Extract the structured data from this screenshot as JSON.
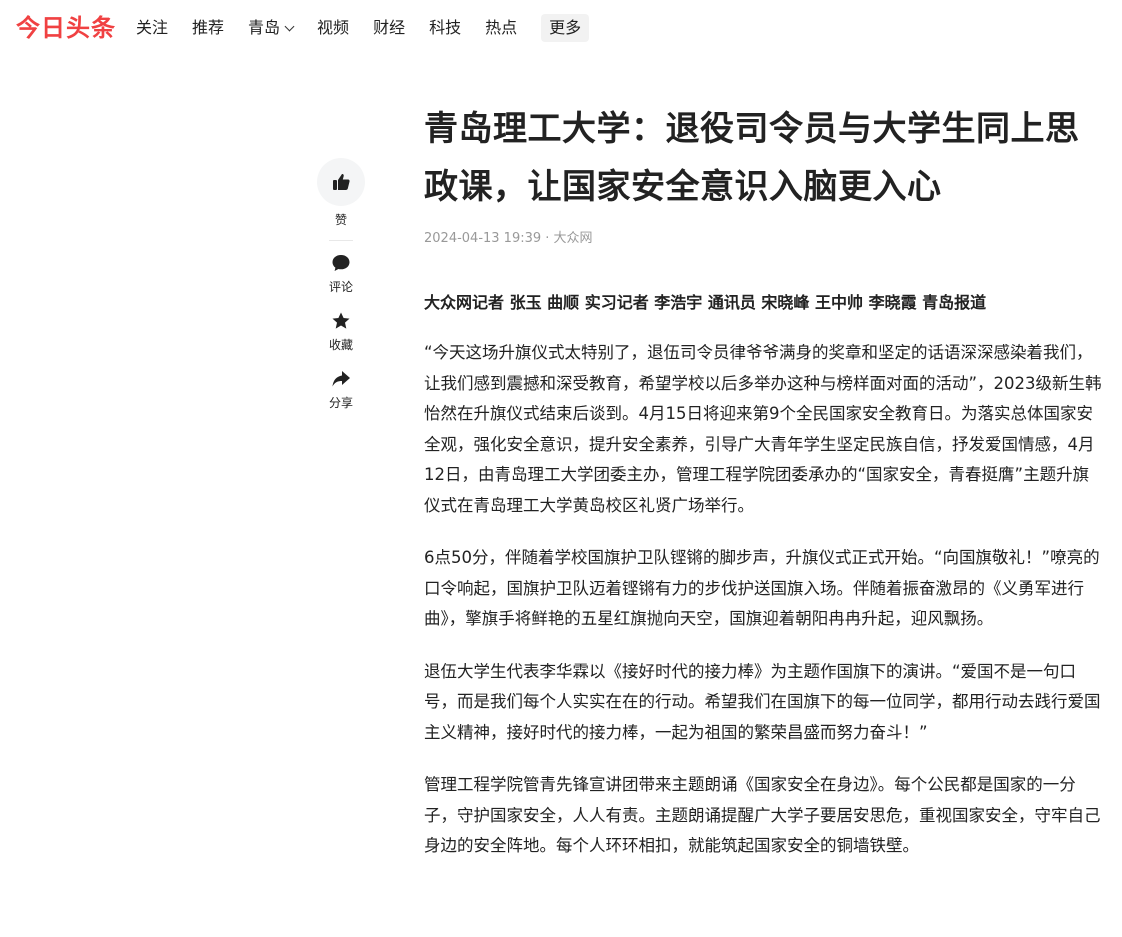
{
  "brand": {
    "logo": "今日头条",
    "accent": "#f04142"
  },
  "nav": {
    "items": [
      {
        "label": "关注"
      },
      {
        "label": "推荐"
      },
      {
        "label": "青岛",
        "has_dropdown": true
      },
      {
        "label": "视频"
      },
      {
        "label": "财经"
      },
      {
        "label": "科技"
      },
      {
        "label": "热点"
      },
      {
        "label": "更多",
        "highlighted": true
      }
    ]
  },
  "sidebar": {
    "like": {
      "label": "赞",
      "icon": "thumbs-up-icon"
    },
    "comment": {
      "label": "评论",
      "icon": "comment-icon"
    },
    "favorite": {
      "label": "收藏",
      "icon": "star-icon"
    },
    "share": {
      "label": "分享",
      "icon": "share-icon"
    }
  },
  "article": {
    "title": "青岛理工大学：退役司令员与大学生同上思政课，让国家安全意识入脑更入心",
    "meta": "2024-04-13 19:39 · 大众网",
    "byline": "大众网记者 张玉 曲顺 实习记者 李浩宇 通讯员 宋晓峰 王中帅 李晓霞 青岛报道",
    "paragraphs": [
      "“今天这场升旗仪式太特别了，退伍司令员律爷爷满身的奖章和坚定的话语深深感染着我们，让我们感到震撼和深受教育，希望学校以后多举办这种与榜样面对面的活动”，2023级新生韩怡然在升旗仪式结束后谈到。4月15日将迎来第9个全民国家安全教育日。为落实总体国家安全观，强化安全意识，提升安全素养，引导广大青年学生坚定民族自信，抒发爱国情感，4月12日，由青岛理工大学团委主办，管理工程学院团委承办的“国家安全，青春挺膺”主题升旗仪式在青岛理工大学黄岛校区礼贤广场举行。",
      "6点50分，伴随着学校国旗护卫队铿锵的脚步声，升旗仪式正式开始。“向国旗敬礼！”嘹亮的口令响起，国旗护卫队迈着铿锵有力的步伐护送国旗入场。伴随着振奋激昂的《义勇军进行曲》，擎旗手将鲜艳的五星红旗抛向天空，国旗迎着朝阳冉冉升起，迎风飘扬。",
      "退伍大学生代表李华霖以《接好时代的接力棒》为主题作国旗下的演讲。“爱国不是一句口号，而是我们每个人实实在在的行动。希望我们在国旗下的每一位同学，都用行动去践行爱国主义精神，接好时代的接力棒，一起为祖国的繁荣昌盛而努力奋斗！”",
      "管理工程学院管青先锋宣讲团带来主题朗诵《国家安全在身边》。每个公民都是国家的一分子，守护国家安全，人人有责。主题朗诵提醒广大学子要居安思危，重视国家安全，守牢自己身边的安全阵地。每个人环环相扣，就能筑起国家安全的铜墙铁壁。"
    ]
  }
}
